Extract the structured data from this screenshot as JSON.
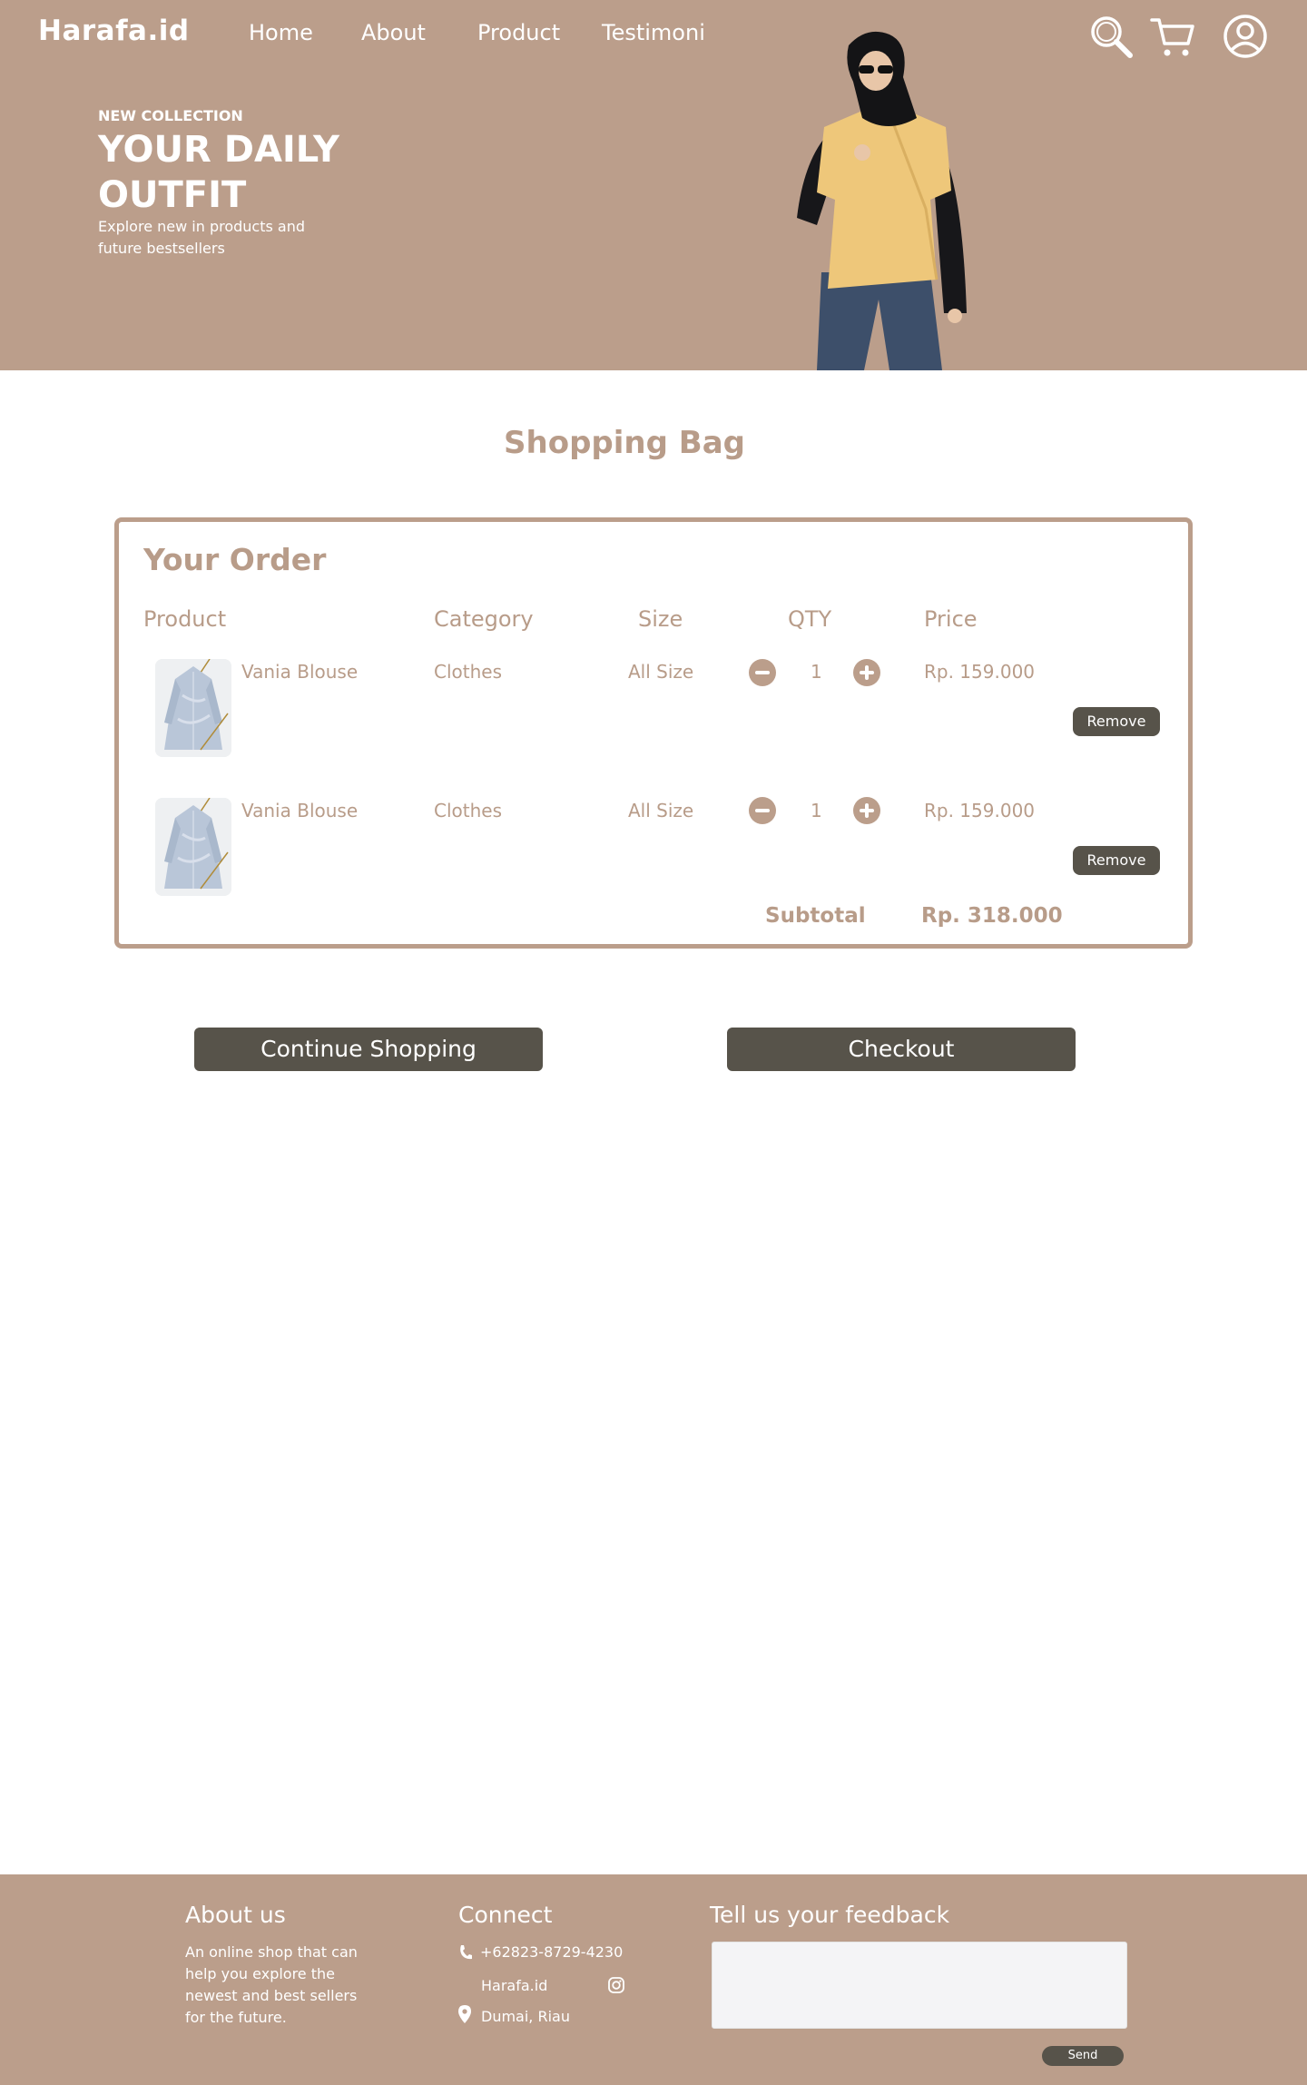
{
  "brand": "Harafa.id",
  "nav": [
    {
      "label": "Home"
    },
    {
      "label": "About"
    },
    {
      "label": "Product"
    },
    {
      "label": "Testimoni"
    }
  ],
  "header_icons": [
    "search-icon",
    "cart-icon",
    "user-icon"
  ],
  "hero": {
    "tag": "NEW COLLECTION",
    "title": "YOUR DAILY OUTFIT",
    "subtitle": "Explore new in products and future bestsellers"
  },
  "page_title": "Shopping Bag",
  "order": {
    "heading": "Your Order",
    "columns": [
      "Product",
      "Category",
      "Size",
      "QTY",
      "Price"
    ],
    "items": [
      {
        "name": "Vania Blouse",
        "category": "Clothes",
        "size": "All Size",
        "qty": "1",
        "price": "Rp. 159.000",
        "remove_label": "Remove"
      },
      {
        "name": "Vania Blouse",
        "category": "Clothes",
        "size": "All Size",
        "qty": "1",
        "price": "Rp. 159.000",
        "remove_label": "Remove"
      }
    ],
    "subtotal_label": "Subtotal",
    "subtotal_value": "Rp. 318.000"
  },
  "actions": {
    "continue_label": "Continue Shopping",
    "checkout_label": "Checkout"
  },
  "footer": {
    "about_heading": "About us",
    "about_text": "An online shop that can help you explore the newest and best sellers for the future.",
    "connect_heading": "Connect",
    "phone": "+62823-8729-4230",
    "instagram": "Harafa.id",
    "location": "Dumai, Riau",
    "feedback_heading": "Tell us your feedback",
    "feedback_value": "",
    "send_label": "Send"
  },
  "colors": {
    "accent": "#bb9e8b",
    "dark_button": "#57534a",
    "text_accent": "#b89c89"
  }
}
